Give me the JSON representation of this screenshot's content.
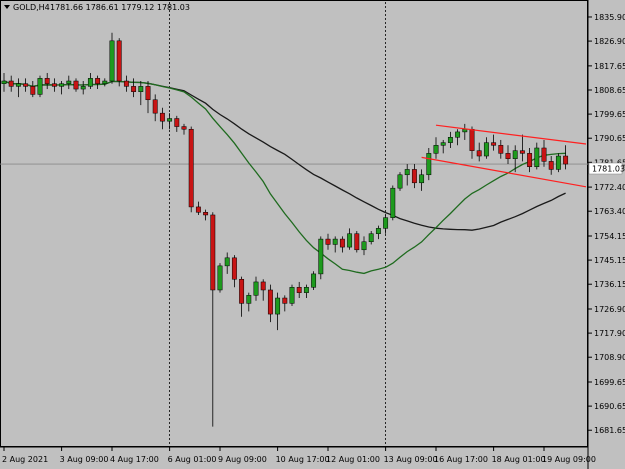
{
  "header": {
    "symbol_timeframe": "GOLD,H4",
    "ohlc": "1781.66 1786.61 1779.12 1781.03"
  },
  "price_tag": {
    "value": "1781.03"
  },
  "colors": {
    "background": "#c0c0c0",
    "bull": "#1e9a1e",
    "bear": "#c81414",
    "ma_fast": "#1f6b1f",
    "ma_slow": "#1a1a1a",
    "trendline": "#ff2020",
    "price_line": "#8a8a8a"
  },
  "chart_data": {
    "type": "candlestick",
    "title": "GOLD,H4",
    "ylim": [
      1678,
      1840
    ],
    "price_ticks": [
      "1835.90",
      "1826.90",
      "1817.65",
      "1808.65",
      "1799.65",
      "1790.65",
      "1781.65",
      "1772.40",
      "1763.40",
      "1754.15",
      "1745.15",
      "1736.15",
      "1726.90",
      "1717.90",
      "1708.90",
      "1699.65",
      "1690.65",
      "1681.65"
    ],
    "time_labels": [
      "2 Aug 2021",
      "3 Aug 09:00",
      "4 Aug 17:00",
      "6 Aug 01:00",
      "9 Aug 09:00",
      "10 Aug 17:00",
      "12 Aug 01:00",
      "13 Aug 09:00",
      "16 Aug 17:00",
      "18 Aug 01:00",
      "19 Aug 09:00"
    ],
    "vertical_separators": [
      "6 Aug 01:00",
      "13 Aug 09:00"
    ],
    "candles": [
      [
        1811,
        1815,
        1808,
        1812
      ],
      [
        1812,
        1814,
        1808,
        1810
      ],
      [
        1810,
        1813,
        1806,
        1811
      ],
      [
        1811,
        1813,
        1808,
        1810
      ],
      [
        1810,
        1812,
        1806,
        1807
      ],
      [
        1807,
        1814,
        1806,
        1813
      ],
      [
        1813,
        1815,
        1809,
        1811
      ],
      [
        1811,
        1813,
        1808,
        1810
      ],
      [
        1810,
        1812,
        1807,
        1811
      ],
      [
        1811,
        1814,
        1809,
        1812
      ],
      [
        1812,
        1813,
        1808,
        1809
      ],
      [
        1809,
        1812,
        1807,
        1810
      ],
      [
        1810,
        1815,
        1809,
        1813
      ],
      [
        1813,
        1814,
        1809,
        1811
      ],
      [
        1811,
        1813,
        1810,
        1812
      ],
      [
        1812,
        1830,
        1811,
        1827
      ],
      [
        1827,
        1828,
        1810,
        1812
      ],
      [
        1812,
        1814,
        1808,
        1810
      ],
      [
        1810,
        1813,
        1806,
        1808
      ],
      [
        1808,
        1812,
        1803,
        1810
      ],
      [
        1810,
        1812,
        1800,
        1805
      ],
      [
        1805,
        1807,
        1797,
        1800
      ],
      [
        1800,
        1802,
        1794,
        1797
      ],
      [
        1797,
        1800,
        1794,
        1798
      ],
      [
        1798,
        1799,
        1793,
        1795
      ],
      [
        1795,
        1796,
        1792,
        1794
      ],
      [
        1794,
        1795,
        1763,
        1765
      ],
      [
        1765,
        1767,
        1762,
        1763
      ],
      [
        1763,
        1764,
        1760,
        1762
      ],
      [
        1762,
        1763,
        1683,
        1734
      ],
      [
        1734,
        1744,
        1733,
        1743
      ],
      [
        1743,
        1748,
        1740,
        1746
      ],
      [
        1746,
        1747,
        1735,
        1738
      ],
      [
        1738,
        1739,
        1724,
        1729
      ],
      [
        1729,
        1733,
        1726,
        1732
      ],
      [
        1732,
        1739,
        1730,
        1737
      ],
      [
        1737,
        1738,
        1730,
        1734
      ],
      [
        1734,
        1736,
        1722,
        1725
      ],
      [
        1725,
        1733,
        1719,
        1731
      ],
      [
        1731,
        1732,
        1726,
        1729
      ],
      [
        1729,
        1736,
        1728,
        1735
      ],
      [
        1735,
        1737,
        1731,
        1733
      ],
      [
        1733,
        1736,
        1731,
        1735
      ],
      [
        1735,
        1741,
        1734,
        1740
      ],
      [
        1740,
        1754,
        1738,
        1753
      ],
      [
        1753,
        1755,
        1749,
        1751
      ],
      [
        1751,
        1754,
        1748,
        1753
      ],
      [
        1753,
        1754,
        1748,
        1750
      ],
      [
        1750,
        1757,
        1749,
        1755
      ],
      [
        1755,
        1756,
        1748,
        1749
      ],
      [
        1749,
        1754,
        1747,
        1752
      ],
      [
        1752,
        1756,
        1751,
        1755
      ],
      [
        1755,
        1758,
        1753,
        1757
      ],
      [
        1757,
        1762,
        1755,
        1761
      ],
      [
        1761,
        1773,
        1760,
        1772
      ],
      [
        1772,
        1778,
        1771,
        1777
      ],
      [
        1777,
        1781,
        1773,
        1779
      ],
      [
        1779,
        1781,
        1772,
        1774
      ],
      [
        1774,
        1779,
        1771,
        1777
      ],
      [
        1777,
        1787,
        1775,
        1785
      ],
      [
        1785,
        1791,
        1783,
        1788
      ],
      [
        1788,
        1790,
        1785,
        1789
      ],
      [
        1789,
        1793,
        1787,
        1791
      ],
      [
        1791,
        1794,
        1788,
        1793
      ],
      [
        1793,
        1796,
        1790,
        1794
      ],
      [
        1794,
        1795,
        1783,
        1786
      ],
      [
        1786,
        1789,
        1782,
        1784
      ],
      [
        1784,
        1791,
        1783,
        1789
      ],
      [
        1789,
        1792,
        1786,
        1788
      ],
      [
        1788,
        1790,
        1783,
        1785
      ],
      [
        1785,
        1788,
        1781,
        1783
      ],
      [
        1783,
        1788,
        1778,
        1786
      ],
      [
        1786,
        1792,
        1782,
        1785
      ],
      [
        1785,
        1787,
        1778,
        1780
      ],
      [
        1780,
        1789,
        1779,
        1787
      ],
      [
        1787,
        1790,
        1780,
        1782
      ],
      [
        1782,
        1784,
        1777,
        1779
      ],
      [
        1779,
        1785,
        1778,
        1784
      ],
      [
        1784,
        1788,
        1779,
        1781
      ]
    ]
  }
}
